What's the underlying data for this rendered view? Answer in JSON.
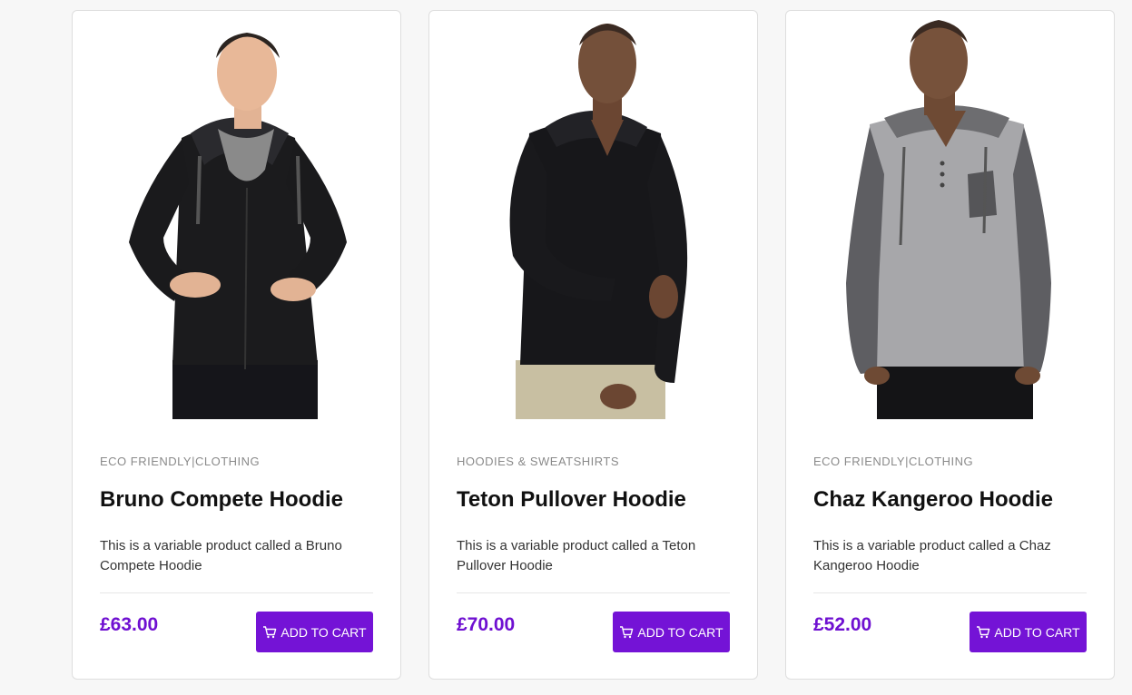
{
  "products": [
    {
      "category": "ECO FRIENDLY|CLOTHING",
      "title": "Bruno Compete Hoodie",
      "description": "This is a variable product called a Bruno Compete Hoodie",
      "price": "£63.00",
      "button_label": "ADD TO CART",
      "image_icon": "product-photo-black-zip-hoodie"
    },
    {
      "category": "HOODIES & SWEATSHIRTS",
      "title": "Teton Pullover Hoodie",
      "description": "This is a variable product called a Teton Pullover Hoodie",
      "price": "£70.00",
      "button_label": "ADD TO CART",
      "image_icon": "product-photo-black-pullover-hoodie"
    },
    {
      "category": "ECO FRIENDLY|CLOTHING",
      "title": "Chaz Kangeroo Hoodie",
      "description": "This is a variable product called a Chaz Kangeroo Hoodie",
      "price": "£52.00",
      "button_label": "ADD TO CART",
      "image_icon": "product-photo-grey-henley-hoodie"
    }
  ],
  "colors": {
    "accent": "#7413d6",
    "price": "#6f10d1",
    "category_text": "#8a8a8a",
    "title_text": "#111111",
    "page_background": "#f7f7f7"
  },
  "icons": {
    "cart": "cart-icon"
  }
}
